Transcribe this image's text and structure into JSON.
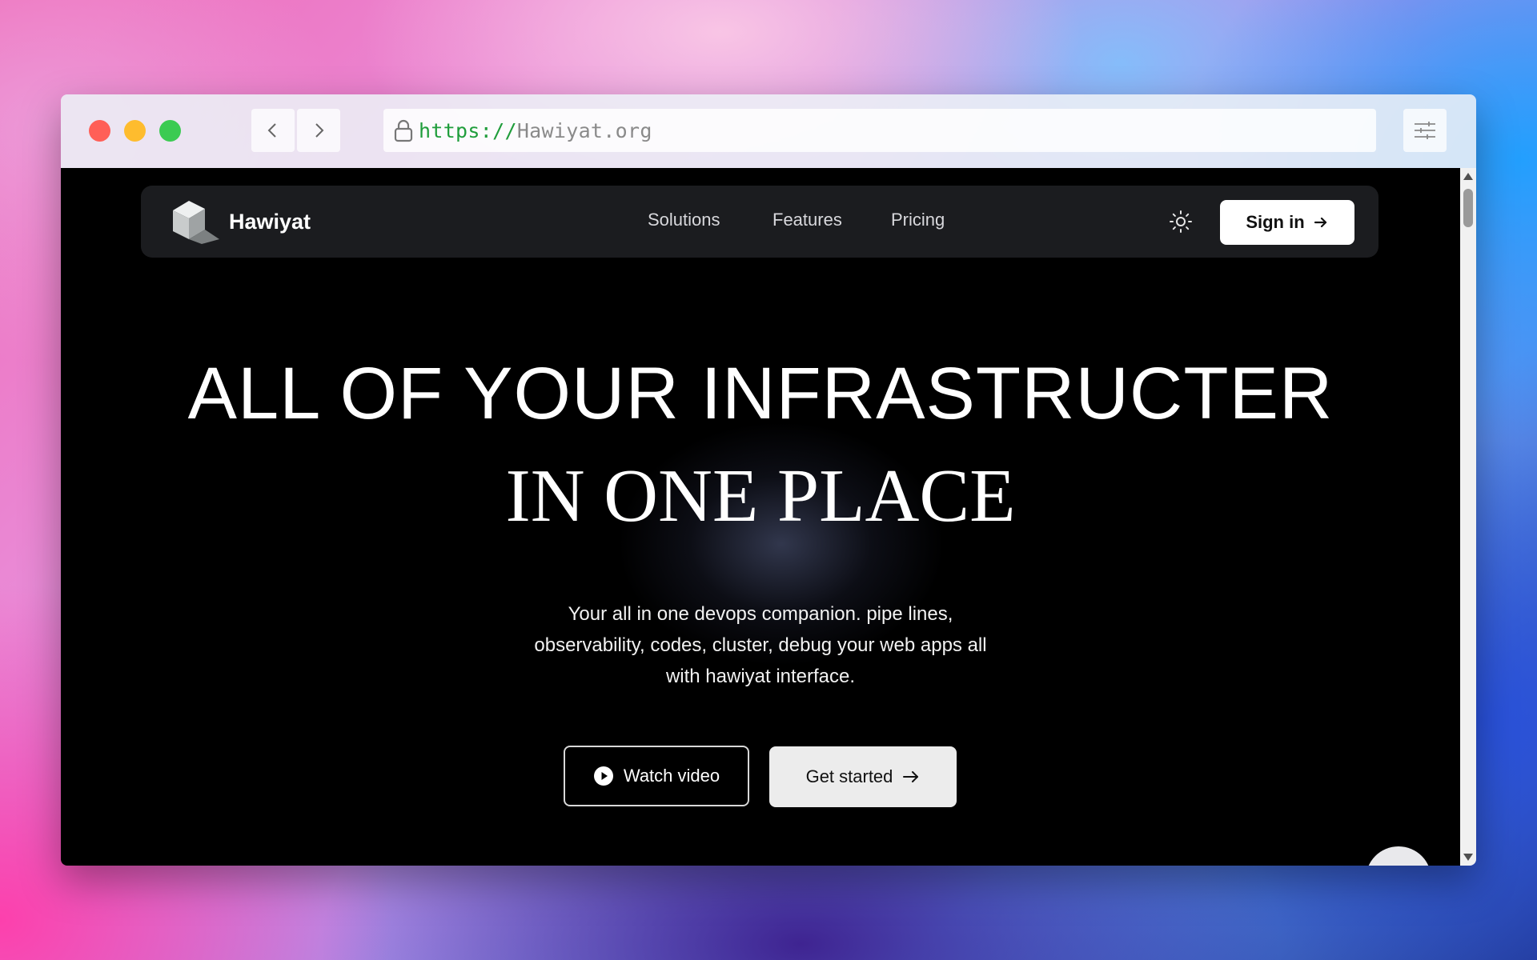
{
  "browser": {
    "url_scheme": "https://",
    "url_host": "Hawiyat.org",
    "icons": {
      "back": "chevron-left-icon",
      "forward": "chevron-right-icon",
      "lock": "lock-icon",
      "settings": "sliders-icon"
    }
  },
  "site": {
    "brand_name": "Hawiyat",
    "nav": {
      "solutions": "Solutions",
      "features": "Features",
      "pricing": "Pricing"
    },
    "sign_in_label": "Sign in",
    "hero": {
      "line1": "ALL OF YOUR INFRASTRUCTER",
      "line2": "IN ONE PLACE",
      "subtitle": "Your all in one devops companion. pipe lines, observability, codes, cluster, debug your web apps all with hawiyat interface."
    },
    "watch_video_label": "Watch video",
    "get_started_label": "Get started",
    "colors": {
      "background": "#000000",
      "nav_background": "#1b1c1f",
      "primary_button": "#ffffff",
      "secondary_button": "#ececec",
      "url_scheme": "#1f9d3b"
    }
  }
}
